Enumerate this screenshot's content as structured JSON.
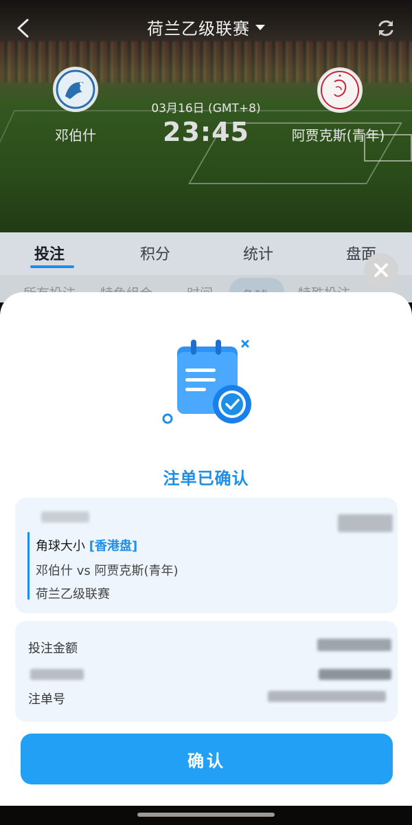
{
  "header": {
    "league_title": "荷兰乙级联赛",
    "home_team": "邓伯什",
    "away_team": "阿贾克斯(青年)",
    "date": "03月16日 (GMT+8)",
    "time": "23:45"
  },
  "tabs": [
    {
      "label": "投注",
      "active": true
    },
    {
      "label": "积分",
      "active": false
    },
    {
      "label": "统计",
      "active": false
    },
    {
      "label": "盘面",
      "active": false
    }
  ],
  "subtabs": [
    "所有投注",
    "特色组合",
    "时间",
    "角球",
    "特殊投注"
  ],
  "modal": {
    "title": "注单已确认",
    "bet": {
      "market": "角球大小",
      "market_tag": "[香港盘]",
      "match": "邓伯什 vs 阿贾克斯(青年)",
      "league": "荷兰乙级联赛"
    },
    "info": {
      "stake_label": "投注金额",
      "order_label": "注单号"
    },
    "confirm_label": "确认"
  },
  "colors": {
    "accent": "#1e8fe6",
    "button": "#22a0f6",
    "card_bg": "#eef5fc"
  },
  "icons": [
    "back-icon",
    "refresh-icon",
    "close-icon",
    "calendar-check-icon",
    "chevron-down-icon"
  ]
}
